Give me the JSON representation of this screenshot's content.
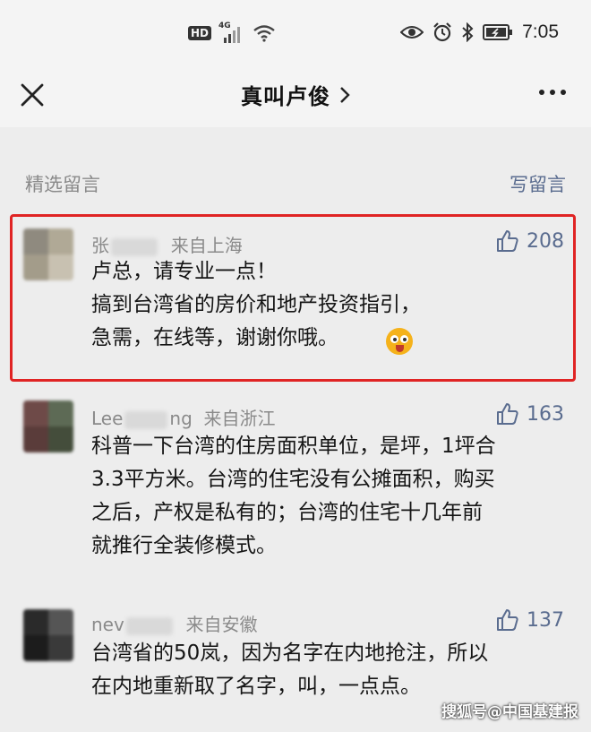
{
  "status": {
    "hd": "HD",
    "network": "4G",
    "time": "7:05"
  },
  "header": {
    "title": "真叫卢俊",
    "chevron": "›"
  },
  "section": {
    "label": "精选留言",
    "write_label": "写留言"
  },
  "comments": [
    {
      "name_start": "张",
      "name_end": "",
      "location": "来自上海",
      "likes": "208",
      "lines": [
        "卢总，请专业一点！",
        "搞到台湾省的房价和地产投资指引，",
        "急需，在线等，谢谢你哦。"
      ],
      "emoji": "surprised-face",
      "highlighted": true
    },
    {
      "name_start": "Lee",
      "name_end": "ng",
      "location": "来自浙江",
      "likes": "163",
      "lines": [
        "科普一下台湾的住房面积单位，是坪，1坪合",
        "3.3平方米。台湾的住宅没有公摊面积，购买",
        "之后，产权是私有的；台湾的住宅十几年前",
        "就推行全装修模式。"
      ]
    },
    {
      "name_start": "nev",
      "name_end": "",
      "location": "来自安徽",
      "likes": "137",
      "lines": [
        "台湾省的50岚，因为名字在内地抢注，所以",
        "在内地重新取了名字，叫，一点点。"
      ]
    }
  ],
  "watermark": "搜狐号@中国基建报",
  "colors": {
    "background": "#ededed",
    "accent": "#5a6c8f",
    "highlight_border": "#e02424"
  }
}
